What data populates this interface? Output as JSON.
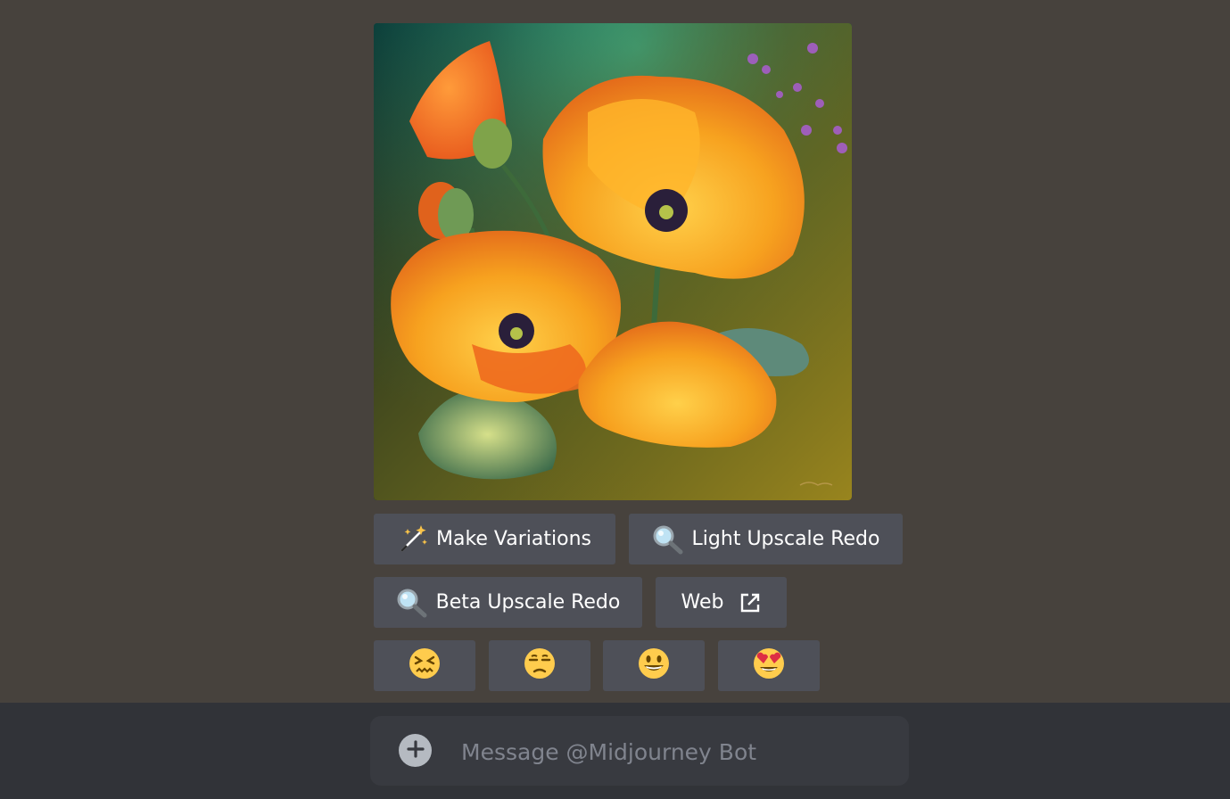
{
  "actions": {
    "make_variations": {
      "label": "Make Variations",
      "icon": "magic-wand-sparkle-icon"
    },
    "light_upscale_redo": {
      "label": "Light Upscale Redo",
      "icon": "magnifying-glass-icon"
    },
    "beta_upscale_redo": {
      "label": "Beta Upscale Redo",
      "icon": "magnifying-glass-icon"
    },
    "web": {
      "label": "Web",
      "icon": "external-link-icon"
    }
  },
  "reactions": [
    {
      "emoji": "😖",
      "icon": "confounded-face-icon"
    },
    {
      "emoji": "😒",
      "icon": "unamused-face-icon"
    },
    {
      "emoji": "😀",
      "icon": "grinning-face-icon"
    },
    {
      "emoji": "😍",
      "icon": "heart-eyes-face-icon"
    }
  ],
  "composer": {
    "placeholder": "Message @Midjourney Bot"
  },
  "colors": {
    "chat_bg": "#47423d",
    "button_bg": "#4e5058",
    "composer_bar_bg": "#313338",
    "composer_bg": "#383a40",
    "placeholder": "#80848e"
  }
}
